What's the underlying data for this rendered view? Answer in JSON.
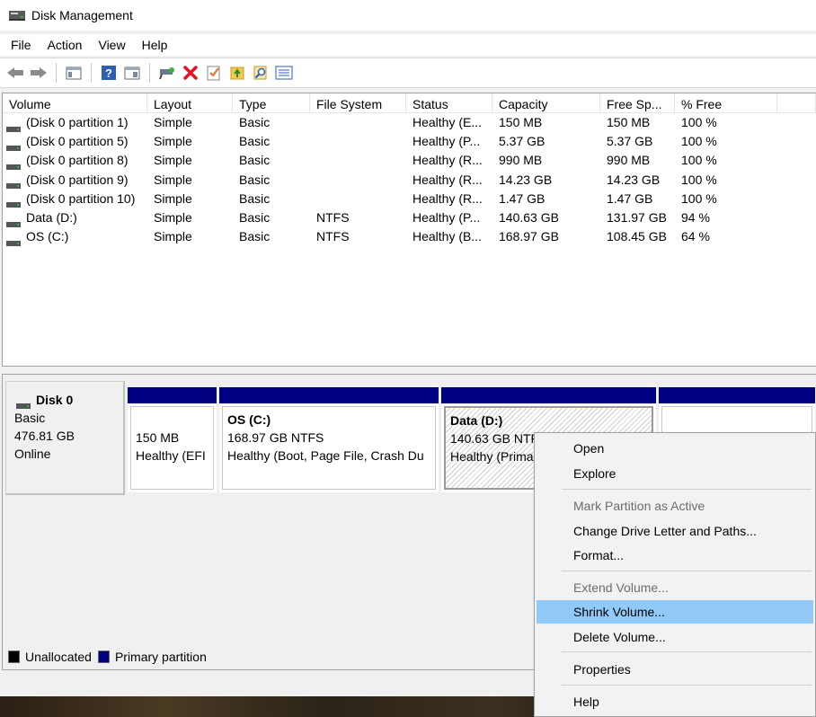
{
  "window": {
    "title": "Disk Management",
    "icon": "disk-management-icon"
  },
  "menu": [
    "File",
    "Action",
    "View",
    "Help"
  ],
  "toolbar": {
    "buttons": [
      "back-icon",
      "forward-icon",
      "console-tree-icon",
      "help-icon",
      "properties-pane-icon",
      "connect-icon",
      "delete-icon",
      "check-icon",
      "up-folder-icon",
      "search-icon",
      "list-icon"
    ]
  },
  "volume_list": {
    "columns": [
      "Volume",
      "Layout",
      "Type",
      "File System",
      "Status",
      "Capacity",
      "Free Sp...",
      "% Free"
    ],
    "rows": [
      {
        "volume": "(Disk 0 partition 1)",
        "layout": "Simple",
        "type": "Basic",
        "fs": "",
        "status": "Healthy (E...",
        "capacity": "150 MB",
        "free": "150 MB",
        "pct": "100 %"
      },
      {
        "volume": "(Disk 0 partition 5)",
        "layout": "Simple",
        "type": "Basic",
        "fs": "",
        "status": "Healthy (P...",
        "capacity": "5.37 GB",
        "free": "5.37 GB",
        "pct": "100 %"
      },
      {
        "volume": "(Disk 0 partition 8)",
        "layout": "Simple",
        "type": "Basic",
        "fs": "",
        "status": "Healthy (R...",
        "capacity": "990 MB",
        "free": "990 MB",
        "pct": "100 %"
      },
      {
        "volume": "(Disk 0 partition 9)",
        "layout": "Simple",
        "type": "Basic",
        "fs": "",
        "status": "Healthy (R...",
        "capacity": "14.23 GB",
        "free": "14.23 GB",
        "pct": "100 %"
      },
      {
        "volume": "(Disk 0 partition 10)",
        "layout": "Simple",
        "type": "Basic",
        "fs": "",
        "status": "Healthy (R...",
        "capacity": "1.47 GB",
        "free": "1.47 GB",
        "pct": "100 %"
      },
      {
        "volume": "Data (D:)",
        "layout": "Simple",
        "type": "Basic",
        "fs": "NTFS",
        "status": "Healthy (P...",
        "capacity": "140.63 GB",
        "free": "131.97 GB",
        "pct": "94 %"
      },
      {
        "volume": "OS (C:)",
        "layout": "Simple",
        "type": "Basic",
        "fs": "NTFS",
        "status": "Healthy (B...",
        "capacity": "168.97 GB",
        "free": "108.45 GB",
        "pct": "64 %"
      }
    ]
  },
  "disk": {
    "name": "Disk 0",
    "kind": "Basic",
    "size": "476.81 GB",
    "state": "Online",
    "partitions": [
      {
        "title": "",
        "size": "150 MB",
        "status": "Healthy (EFI"
      },
      {
        "title": "OS  (C:)",
        "size": "168.97 GB NTFS",
        "status": "Healthy (Boot, Page File, Crash Du"
      },
      {
        "title": "Data  (D:)",
        "size": "140.63 GB NTF",
        "status": "Healthy (Prima"
      },
      {
        "title": "",
        "size": "",
        "status": ""
      }
    ]
  },
  "legend": [
    {
      "label": "Unallocated",
      "color": "#000000"
    },
    {
      "label": "Primary partition",
      "color": "#000080"
    }
  ],
  "context_menu": {
    "items": [
      {
        "label": "Open",
        "disabled": false
      },
      {
        "label": "Explore",
        "disabled": false
      },
      {
        "label": "Mark Partition as Active",
        "disabled": true
      },
      {
        "label": "Change Drive Letter and Paths...",
        "disabled": false
      },
      {
        "label": "Format...",
        "disabled": false
      },
      {
        "label": "Extend Volume...",
        "disabled": true
      },
      {
        "label": "Shrink Volume...",
        "disabled": false,
        "highlighted": true
      },
      {
        "label": "Delete Volume...",
        "disabled": false
      },
      {
        "label": "Properties",
        "disabled": false
      },
      {
        "label": "Help",
        "disabled": false
      }
    ]
  },
  "colors": {
    "primary_partition": "#000080",
    "menu_highlight": "#91c9f7",
    "delete_red": "#e81123"
  }
}
